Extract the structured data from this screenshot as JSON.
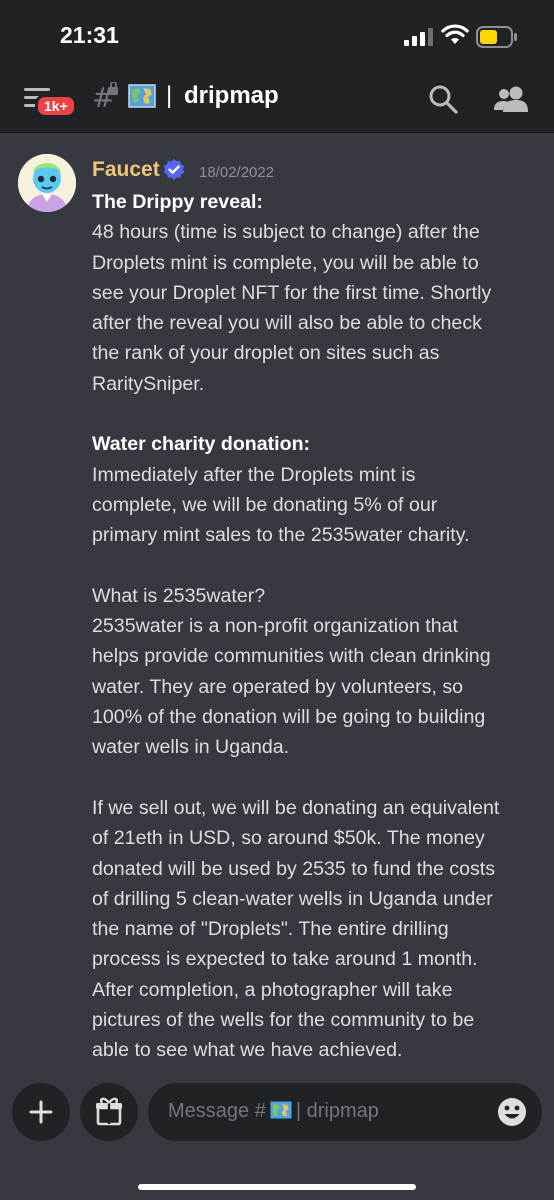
{
  "status_bar": {
    "time": "21:31"
  },
  "header": {
    "badge": "1k+",
    "separator": "|",
    "channel_name": "dripmap",
    "icons": [
      "menu-icon",
      "hash-lock-icon",
      "map-emoji-icon",
      "search-icon",
      "members-icon"
    ]
  },
  "message": {
    "author": "Faucet",
    "timestamp": "18/02/2022",
    "lines": [
      {
        "text": "The Drippy reveal:",
        "bold": true
      },
      {
        "text": "48 hours (time is subject to change) after the"
      },
      {
        "text": "Droplets mint is complete, you will be able to"
      },
      {
        "text": "see your Droplet NFT for the first time. Shortly"
      },
      {
        "text": "after the reveal you will also be able to check"
      },
      {
        "text": "the rank of your droplet on sites such as"
      },
      {
        "text": "RaritySniper."
      },
      {
        "text": ""
      },
      {
        "text": "Water charity donation:",
        "bold": true
      },
      {
        "text": "Immediately after the Droplets mint is"
      },
      {
        "text": "complete, we will be donating 5% of our"
      },
      {
        "text": "primary mint sales to the 2535water charity."
      },
      {
        "text": ""
      },
      {
        "text": "What is 2535water?"
      },
      {
        "text": "2535water is a non-profit organization that"
      },
      {
        "text": "helps provide communities with clean drinking"
      },
      {
        "text": "water. They are operated by volunteers, so"
      },
      {
        "text": "100% of the donation will be going to building"
      },
      {
        "text": "water wells in Uganda."
      },
      {
        "text": ""
      },
      {
        "text": "If we sell out, we will be donating an equivalent"
      },
      {
        "text": "of 21eth in USD, so around $50k. The money"
      },
      {
        "text": "donated will be used by 2535 to fund the costs"
      },
      {
        "text": "of drilling 5 clean-water wells in Uganda under"
      },
      {
        "text": "the name of \"Droplets\". The entire drilling"
      },
      {
        "text": "process is expected to take around 1 month."
      },
      {
        "text": "After completion, a photographer will take"
      },
      {
        "text": "pictures of the wells for the community to be"
      },
      {
        "text": "able to see what we have achieved."
      }
    ]
  },
  "composer": {
    "placeholder_prefix": "Message #",
    "placeholder_suffix": "| dripmap",
    "icons": [
      "plus-icon",
      "gift-icon",
      "emoji-icon"
    ]
  },
  "colors": {
    "background": "#36393f",
    "header_bg": "#202225",
    "author_color": "#f0c674",
    "verified_blue": "#5865f2",
    "badge_red": "#ed4245"
  }
}
